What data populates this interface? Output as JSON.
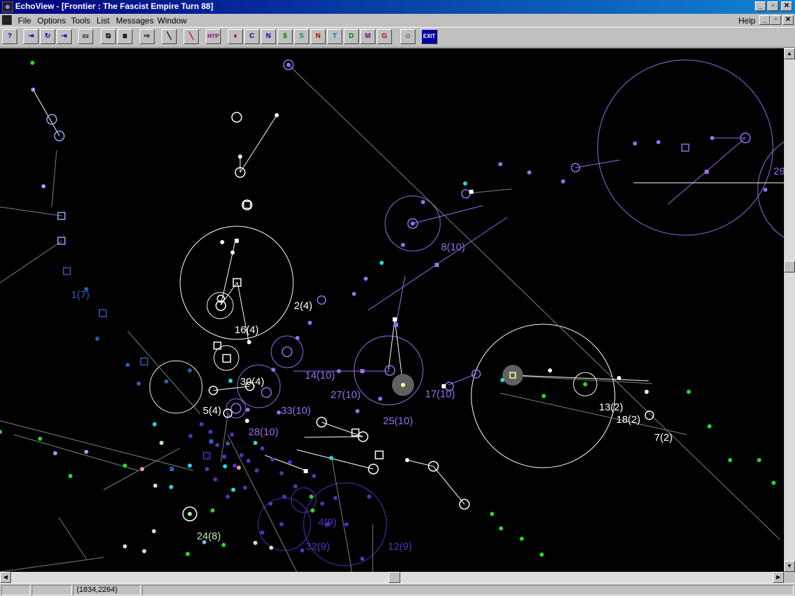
{
  "window": {
    "title": "EchoView - [Frontier : The Fascist Empire Turn 88]",
    "controls": [
      "minimize",
      "restore",
      "close"
    ]
  },
  "menu": {
    "items": [
      "File",
      "Options",
      "Tools",
      "List",
      "Messages",
      "Window"
    ],
    "help": "Help"
  },
  "toolbar": {
    "icons": [
      "help-icon",
      "jump-right-icon",
      "jump-back-icon",
      "jump-to-icon",
      "window-icon",
      "copy-view-icon",
      "paste-view-icon",
      "export-icon",
      "line-tool-icon",
      "pen-tool-icon",
      "hyperspace-icon",
      "thrust-icon",
      "colony-icon",
      "navy-icon",
      "money-icon",
      "ship-icon",
      "nav-red-icon",
      "tech-icon",
      "defense-icon",
      "military-icon",
      "gsm-icon",
      "robot-icon",
      "exit-icon"
    ],
    "hyp_label": "HYP",
    "exit_label": "EXIT",
    "letters": [
      "C",
      "N",
      "S",
      "N",
      "T",
      "D",
      "M"
    ]
  },
  "map": {
    "labels": [
      {
        "text": "1(7)",
        "color": "#2a5fb0"
      },
      {
        "text": "2(4)",
        "color": "#ffffff"
      },
      {
        "text": "16(4)",
        "color": "#ffffff"
      },
      {
        "text": "30(4)",
        "color": "#ffffff"
      },
      {
        "text": "5(4)",
        "color": "#ffffff"
      },
      {
        "text": "8(10)",
        "color": "#9a6cf0"
      },
      {
        "text": "14(10)",
        "color": "#9a6cf0"
      },
      {
        "text": "27(10)",
        "color": "#9a6cf0"
      },
      {
        "text": "17(10)",
        "color": "#9a6cf0"
      },
      {
        "text": "25(10)",
        "color": "#9a6cf0"
      },
      {
        "text": "33(10)",
        "color": "#9a6cf0"
      },
      {
        "text": "28(10)",
        "color": "#9a6cf0"
      },
      {
        "text": "13(2)",
        "color": "#ffffff"
      },
      {
        "text": "18(2)",
        "color": "#ffffff"
      },
      {
        "text": "7(2)",
        "color": "#ffffff"
      },
      {
        "text": "4(9)",
        "color": "#5a2ec0"
      },
      {
        "text": "32(9)",
        "color": "#5a2ec0"
      },
      {
        "text": "12(9)",
        "color": "#5a2ec0"
      },
      {
        "text": "24(8)",
        "color": "#b8f0b0"
      },
      {
        "text": "29",
        "color": "#9a6cf0"
      }
    ]
  },
  "status": {
    "coords": "(1834,2264)"
  },
  "colors": {
    "white": "#ffffff",
    "purple": "#9a6cf0",
    "dark_purple": "#5a2ec0",
    "blue": "#2a5fb0",
    "green": "#22dd22",
    "cyan": "#22dddd"
  }
}
